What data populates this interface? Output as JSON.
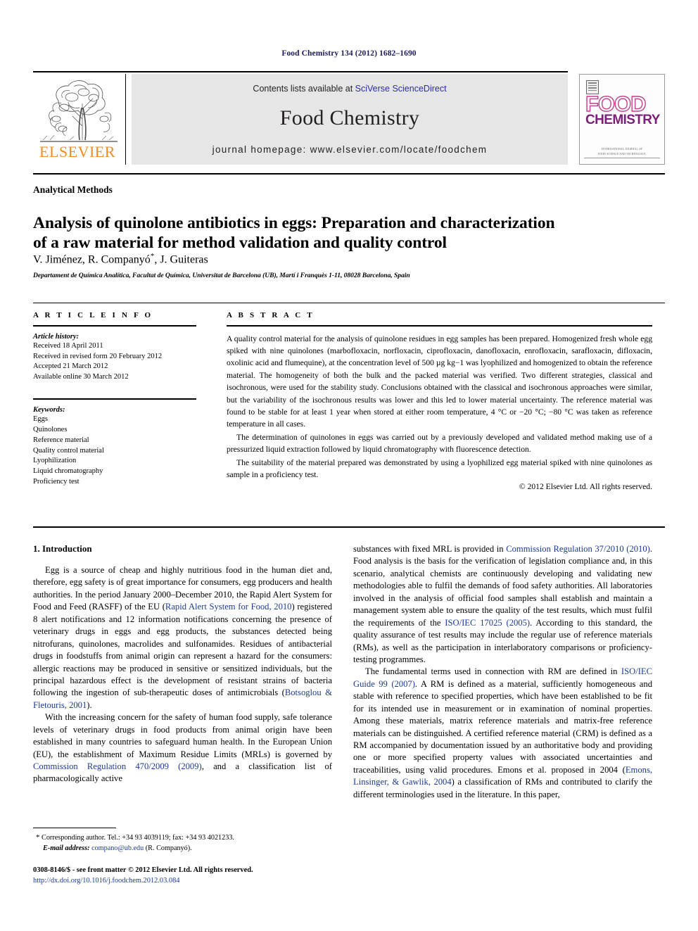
{
  "running_head": "Food Chemistry 134 (2012) 1682–1690",
  "masthead": {
    "publisher_name": "ELSEVIER",
    "publisher_logo_icon": "elsevier-tree-icon",
    "contents_prefix": "Contents lists available at ",
    "contents_link": "SciVerse ScienceDirect",
    "journal_title": "Food Chemistry",
    "homepage_line": "journal homepage: www.elsevier.com/locate/foodchem",
    "cover": {
      "word_top": "FOOD",
      "word_bottom": "CHEMISTRY",
      "footer_line_1": "INTERNATIONAL JOURNAL OF",
      "footer_line_2": "FOOD SCIENCE AND TECHNOLOGY",
      "badge_icon": "journal-logo-icon"
    },
    "link_color": "#2b2bb0",
    "band_color": "#e6e6e6",
    "elsevier_orange": "#F28B20",
    "cover_pink": "#c0408f",
    "cover_purple": "#7b1f7b"
  },
  "section_label": "Analytical Methods",
  "title_line_1": "Analysis of quinolone antibiotics in eggs: Preparation and characterization",
  "title_line_2": "of a raw material for method validation and quality control",
  "authors_prefix": "V. Jiménez, R. Companyó",
  "authors_star": "*",
  "authors_suffix": ", J. Guiteras",
  "affiliation": "Departament de Química Analítica, Facultat de Química, Universitat de Barcelona (UB), Martí i Franquès 1-11, 08028 Barcelona, Spain",
  "article_info": {
    "heading": "A R T I C L E   I N F O",
    "history_label": "Article history:",
    "history": [
      "Received 18 April 2011",
      "Received in revised form 20 February 2012",
      "Accepted 21 March 2012",
      "Available online 30 March 2012"
    ],
    "keywords_label": "Keywords:",
    "keywords": [
      "Eggs",
      "Quinolones",
      "Reference material",
      "Quality control material",
      "Lyophilization",
      "Liquid chromatography",
      "Proficiency test"
    ]
  },
  "abstract": {
    "heading": "A B S T R A C T",
    "paragraph_1": "A quality control material for the analysis of quinolone residues in egg samples has been prepared. Homogenized fresh whole egg spiked with nine quinolones (marbofloxacin, norfloxacin, ciprofloxacin, danofloxacin, enrofloxacin, sarafloxacin, difloxacin, oxolinic acid and flumequine), at the concentration level of 500 µg kg−1 was lyophilized and homogenized to obtain the reference material. The homogeneity of both the bulk and the packed material was verified. Two different strategies, classical and isochronous, were used for the stability study. Conclusions obtained with the classical and isochronous approaches were similar, but the variability of the isochronous results was lower and this led to lower material uncertainty. The reference material was found to be stable for at least 1 year when stored at either room temperature, 4 °C or −20 °C; −80 °C was taken as reference temperature in all cases.",
    "paragraph_2": "The determination of quinolones in eggs was carried out by a previously developed and validated method making use of a pressurized liquid extraction followed by liquid chromatography with fluorescence detection.",
    "paragraph_3": "The suitability of the material prepared was demonstrated by using a lyophilized egg material spiked with nine quinolones as sample in a proficiency test.",
    "copyright": "© 2012 Elsevier Ltd. All rights reserved."
  },
  "introduction": {
    "heading": "1. Introduction",
    "left_p1_a": "Egg is a source of cheap and highly nutritious food in the human diet and, therefore, egg safety is of great importance for consumers, egg producers and health authorities. In the period January 2000–December 2010, the Rapid Alert System for Food and Feed (RASFF) of the EU (",
    "left_p1_cite1": "Rapid Alert System for Food, 2010",
    "left_p1_b": ") registered 8 alert notifications and 12 information notifications concerning the presence of veterinary drugs in eggs and egg products, the substances detected being nitrofurans, quinolones, macrolides and sulfonamides. Residues of antibacterial drugs in foodstuffs from animal origin can represent a hazard for the consumers: allergic reactions may be produced in sensitive or sensitized individuals, but the principal hazardous effect is the development of resistant strains of bacteria following the ingestion of sub-therapeutic doses of antimicrobials (",
    "left_p1_cite2": "Botsoglou & Fletouris, 2001",
    "left_p1_c": ").",
    "left_p2_a": "With the increasing concern for the safety of human food supply, safe tolerance levels of veterinary drugs in food products from animal origin have been established in many countries to safeguard human health. In the European Union (EU), the establishment of Maximum Residue Limits (MRLs) is governed by ",
    "left_p2_cite": "Commission Regulation 470/2009 (2009)",
    "left_p2_b": ", and a classification list of pharmacologically active",
    "right_p1_a": "substances with fixed MRL is provided in ",
    "right_p1_cite1": "Commission Regulation 37/2010 (2010)",
    "right_p1_b": ". Food analysis is the basis for the verification of legislation compliance and, in this scenario, analytical chemists are continuously developing and validating new methodologies able to fulfil the demands of food safety authorities. All laboratories involved in the analysis of official food samples shall establish and maintain a management system able to ensure the quality of the test results, which must fulfil the requirements of the ",
    "right_p1_cite2": "ISO/IEC 17025 (2005)",
    "right_p1_c": ". According to this standard, the quality assurance of test results may include the regular use of reference materials (RMs), as well as the participation in interlaboratory comparisons or proficiency-testing programmes.",
    "right_p2_a": "The fundamental terms used in connection with RM are defined in ",
    "right_p2_cite1": "ISO/IEC Guide 99 (2007)",
    "right_p2_b": ". A RM is defined as a material, sufficiently homogeneous and stable with reference to specified properties, which have been established to be fit for its intended use in measurement or in examination of nominal properties. Among these materials, matrix reference materials and matrix-free reference materials can be distinguished. A certified reference material (CRM) is defined as a RM accompanied by documentation issued by an authoritative body and providing one or more specified property values with associated uncertainties and traceabilities, using valid procedures. Emons et al. proposed in 2004 (",
    "right_p2_cite2": "Emons, Linsinger, & Gawlik, 2004",
    "right_p2_c": ") a classification of RMs and contributed to clarify the different terminologies used in the literature. In this paper,"
  },
  "footnote": {
    "star": "*",
    "corresponding": " Corresponding author. Tel.: +34 93 4039119; fax: +34 93 4021233.",
    "email_label": "E-mail address:",
    "email": "compano@ub.edu",
    "email_suffix": " (R. Companyó)."
  },
  "page_footer": {
    "issn_line": "0308-8146/$ - see front matter © 2012 Elsevier Ltd. All rights reserved.",
    "doi_line": "http://dx.doi.org/10.1016/j.foodchem.2012.03.084"
  }
}
